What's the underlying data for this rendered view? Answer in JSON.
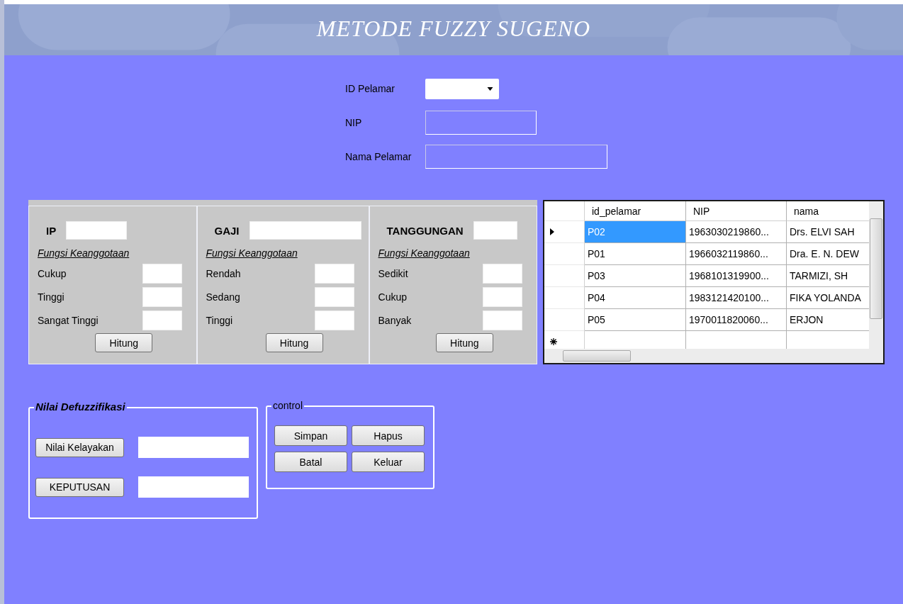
{
  "window": {
    "title": "METODE FUZZY SUGENO"
  },
  "form": [
    {
      "label": "ID Pelamar",
      "kind": "combo"
    },
    {
      "label": "NIP",
      "kind": "text"
    },
    {
      "label": "Nama Pelamar",
      "kind": "text"
    }
  ],
  "panels": [
    {
      "title": "IP",
      "subtitle": "Fungsi Keanggotaan",
      "members": [
        "Cukup",
        "Tinggi",
        "Sangat Tinggi"
      ],
      "button": "Hitung"
    },
    {
      "title": "GAJI",
      "subtitle": "Fungsi Keanggotaan",
      "members": [
        "Rendah",
        "Sedang",
        "Tinggi"
      ],
      "button": "Hitung"
    },
    {
      "title": "TANGGUNGAN",
      "subtitle": "Fungsi Keanggotaan",
      "members": [
        "Sedikit",
        "Cukup",
        "Banyak"
      ],
      "button": "Hitung"
    }
  ],
  "table": {
    "columns": [
      "id_pelamar",
      "NIP",
      "nama"
    ],
    "rows": [
      {
        "cells": [
          "P02",
          "1963030219860...",
          "Drs. ELVI SAH"
        ],
        "selected": true
      },
      {
        "cells": [
          "P01",
          "1966032119860...",
          "Dra. E. N. DEW"
        ],
        "selected": false
      },
      {
        "cells": [
          "P03",
          "1968101319900...",
          "TARMIZI, SH"
        ],
        "selected": false
      },
      {
        "cells": [
          "P04",
          "1983121420100...",
          "FIKA YOLANDA"
        ],
        "selected": false
      },
      {
        "cells": [
          "P05",
          "1970011820060...",
          "ERJON"
        ],
        "selected": false
      }
    ]
  },
  "defuzzification": {
    "title": "Nilai Defuzzifikasi",
    "buttons": [
      "Nilai Kelayakan",
      "KEPUTUSAN"
    ]
  },
  "control": {
    "title": "control",
    "buttons": [
      "Simpan",
      "Hapus",
      "Batal",
      "Keluar"
    ]
  }
}
